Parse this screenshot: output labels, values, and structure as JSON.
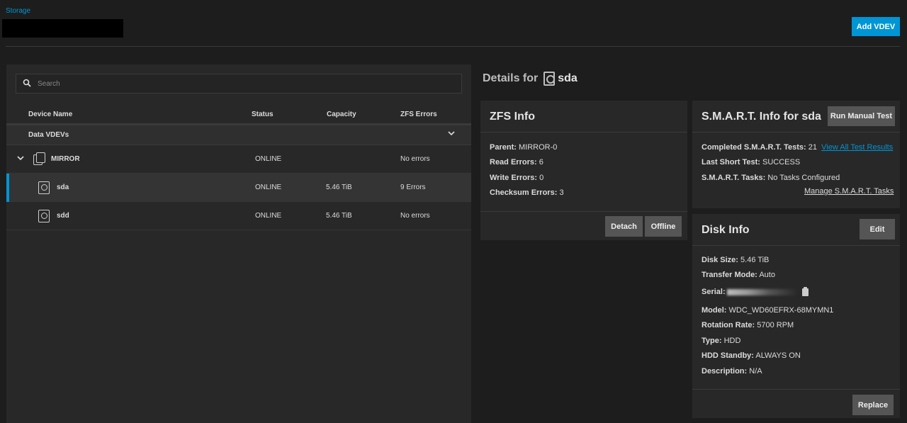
{
  "breadcrumb": "Storage",
  "header": {
    "add_vdev": "Add VDEV"
  },
  "search": {
    "placeholder": "Search"
  },
  "table": {
    "columns": [
      "Device Name",
      "Status",
      "Capacity",
      "ZFS Errors"
    ],
    "group": "Data VDEVs",
    "rows": [
      {
        "name": "MIRROR",
        "status": "ONLINE",
        "capacity": "",
        "errors": "No errors"
      },
      {
        "name": "sda",
        "status": "ONLINE",
        "capacity": "5.46 TiB",
        "errors": "9 Errors"
      },
      {
        "name": "sdd",
        "status": "ONLINE",
        "capacity": "5.46 TiB",
        "errors": "No errors"
      }
    ]
  },
  "details": {
    "prefix": "Details for",
    "disk": "sda"
  },
  "zfs_info": {
    "title": "ZFS Info",
    "parent_label": "Parent:",
    "parent": "MIRROR-0",
    "read_label": "Read Errors:",
    "read": "6",
    "write_label": "Write Errors:",
    "write": "0",
    "checksum_label": "Checksum Errors:",
    "checksum": "3",
    "detach": "Detach",
    "offline": "Offline"
  },
  "smart": {
    "title": "S.M.A.R.T. Info for sda",
    "run_test": "Run Manual Test",
    "completed_label": "Completed S.M.A.R.T. Tests:",
    "completed": "21",
    "view_all": "View All Test Results",
    "last_short_label": "Last Short Test:",
    "last_short": "SUCCESS",
    "tasks_label": "S.M.A.R.T. Tasks:",
    "tasks": "No Tasks Configured",
    "manage": "Manage S.M.A.R.T. Tasks"
  },
  "disk_info": {
    "title": "Disk Info",
    "edit": "Edit",
    "size_label": "Disk Size:",
    "size": "5.46 TiB",
    "transfer_label": "Transfer Mode:",
    "transfer": "Auto",
    "serial_label": "Serial:",
    "model_label": "Model:",
    "model": "WDC_WD60EFRX-68MYMN1",
    "rotation_label": "Rotation Rate:",
    "rotation": "5700 RPM",
    "type_label": "Type:",
    "type": "HDD",
    "standby_label": "HDD Standby:",
    "standby": "ALWAYS ON",
    "description_label": "Description:",
    "description": "N/A",
    "replace": "Replace"
  }
}
